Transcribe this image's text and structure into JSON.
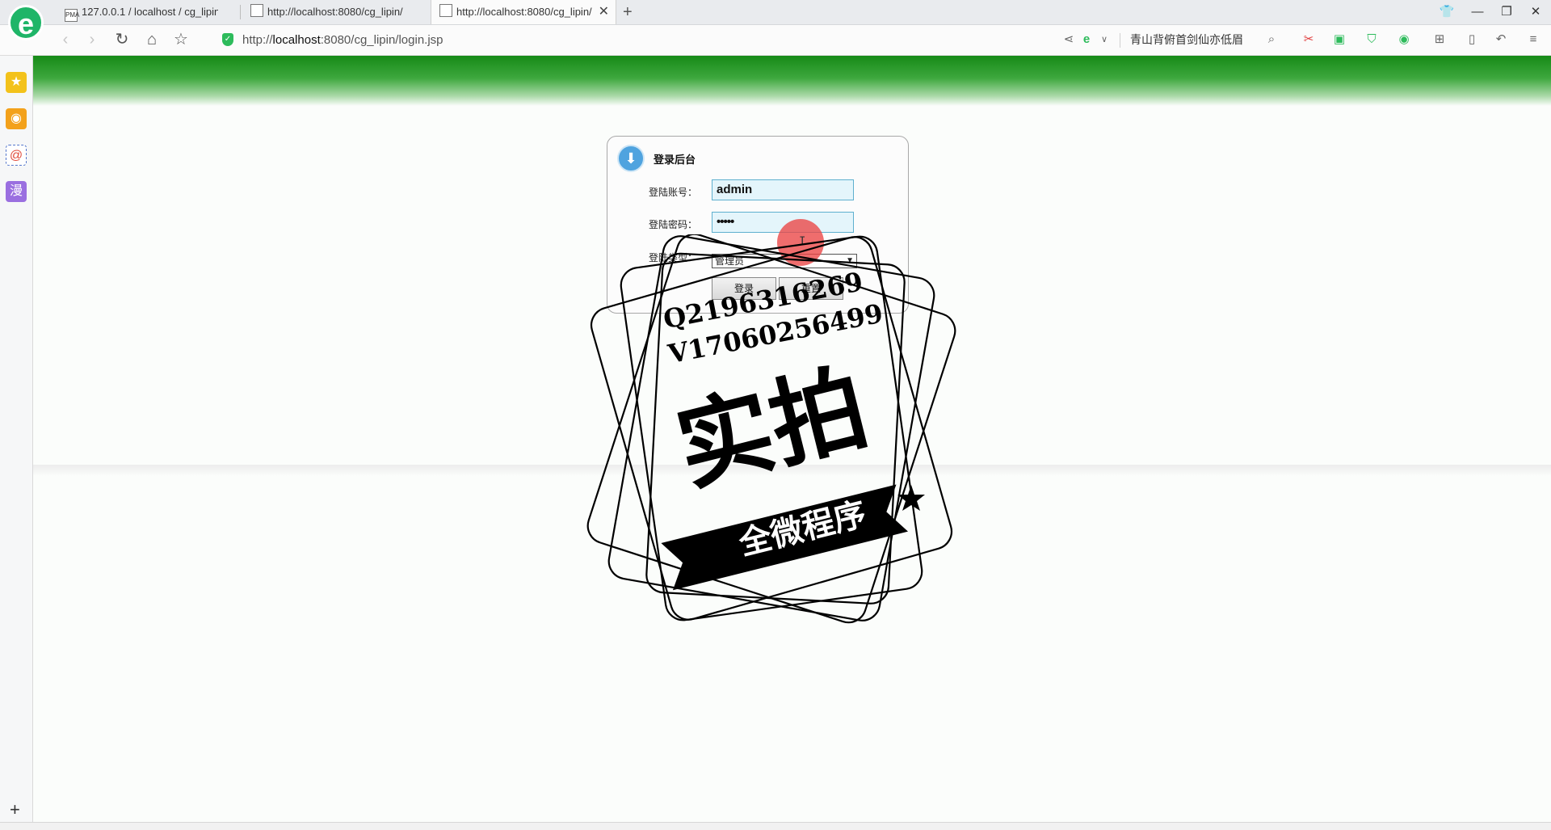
{
  "browser": {
    "tabs": [
      {
        "label": "127.0.0.1 / localhost / cg_lipin",
        "favicon": "PMA"
      },
      {
        "label": "http://localhost:8080/cg_lipin/",
        "favicon": ""
      },
      {
        "label": "http://localhost:8080/cg_lipin/",
        "favicon": ""
      }
    ],
    "address_host": "localhost",
    "address_pre": "http://",
    "address_post": ":8080/cg_lipin/login.jsp",
    "search_text": "青山背俯首剑仙亦低眉"
  },
  "login": {
    "title": "登录后台",
    "account_label": "登陆账号：",
    "account_value": "admin",
    "password_label": "登陆密码：",
    "password_value": "•••••",
    "type_label": "登陆类型：",
    "type_selected": "管理员",
    "submit_label": "登录",
    "reset_label": "重置"
  },
  "watermark": {
    "line1": "Q2196316269",
    "line2": "V17060256499",
    "main": "实拍",
    "ribbon": "全微程序"
  },
  "colors": {
    "banner": "#168a17",
    "field_bg": "#e4f5fb",
    "field_border": "#5eb0cf",
    "accent": "#1fb568"
  }
}
